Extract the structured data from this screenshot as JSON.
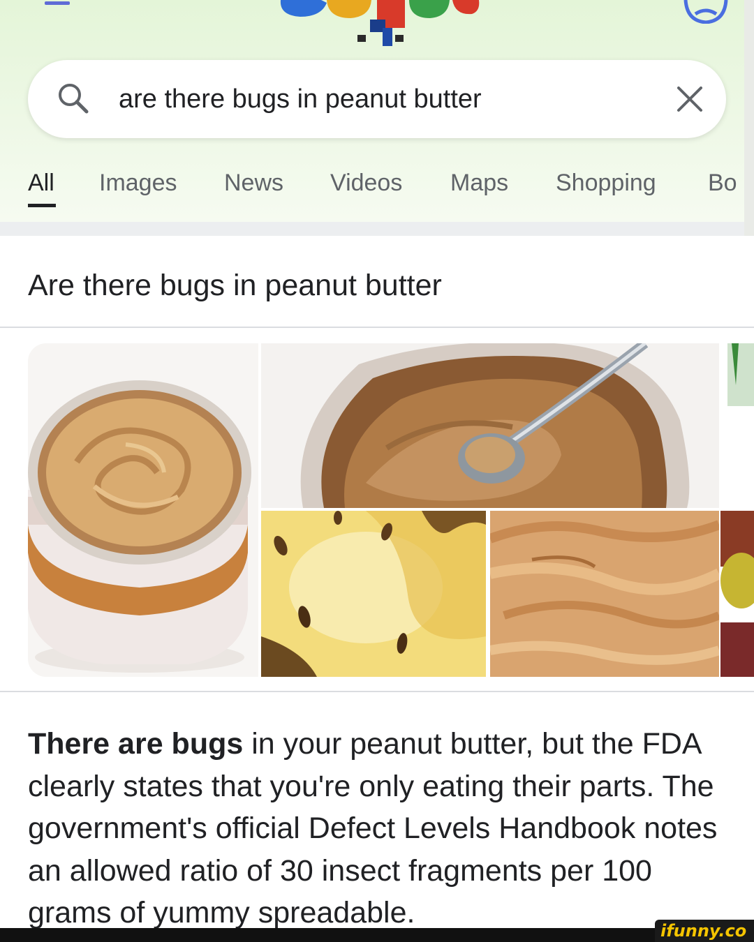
{
  "search": {
    "query": "are there bugs in peanut butter"
  },
  "tabs": [
    {
      "label": "All",
      "active": true
    },
    {
      "label": "Images",
      "active": false
    },
    {
      "label": "News",
      "active": false
    },
    {
      "label": "Videos",
      "active": false
    },
    {
      "label": "Maps",
      "active": false
    },
    {
      "label": "Shopping",
      "active": false
    },
    {
      "label": "Bo",
      "active": false
    }
  ],
  "result": {
    "question": "Are there bugs in peanut butter",
    "snippet_bold": "There are bugs",
    "snippet_rest": " in your peanut butter, but the FDA clearly states that you're only eating their parts. The government's official Defect Levels Handbook notes an allowed ratio of 30 insect fragments per 100 grams of yummy spreadable."
  },
  "images": [
    {
      "icon": "peanut-butter-jar-image"
    },
    {
      "icon": "peanut-butter-spoon-image"
    },
    {
      "icon": "bugs-in-food-image"
    },
    {
      "icon": "peanut-butter-closeup-image"
    },
    {
      "icon": "cropped-food-image"
    }
  ],
  "watermark": {
    "text": "ifunny.co"
  },
  "colors": {
    "header_bg": "#e4f5d8",
    "text": "#202124",
    "tab_inactive": "#5f6368",
    "divider": "#dadce0",
    "watermark": "#f5c400"
  }
}
